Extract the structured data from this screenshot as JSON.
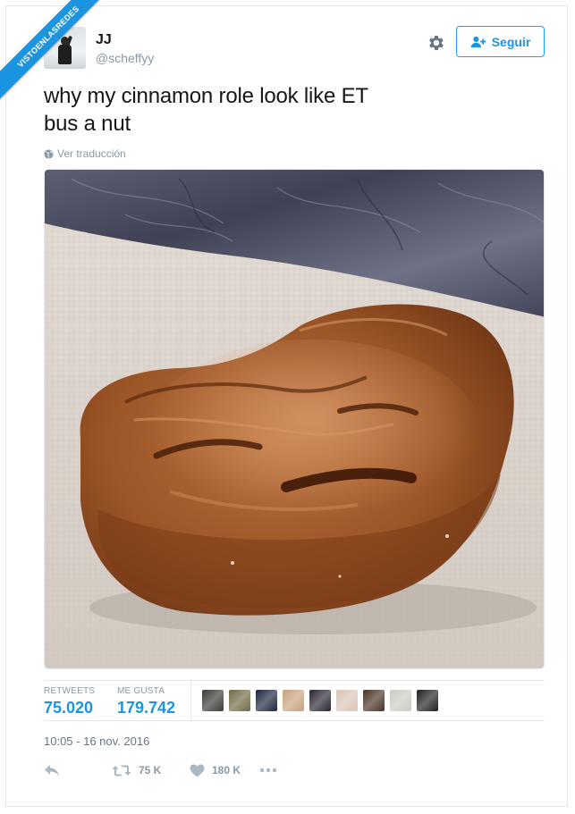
{
  "watermark": {
    "text": "VISTOENLASREDES"
  },
  "author": {
    "display_name": "JJ",
    "screen_name": "@scheffyy"
  },
  "header": {
    "follow_label": "Seguir",
    "settings_icon": "gear-icon",
    "follow_icon": "user-plus-icon"
  },
  "tweet": {
    "text": "why my cinnamon role look like ET\nbus a nut",
    "translate_label": "Ver traducción",
    "translate_icon": "globe-icon",
    "photo_subject": "photo"
  },
  "stats": {
    "retweets_label": "RETWEETS",
    "retweets_value": "75.020",
    "likes_label": "ME GUSTA",
    "likes_value": "179.742",
    "liker_avatars": [
      "#3a3b36",
      "#6f6a45",
      "#1c2640",
      "#c8a27c",
      "#2b2530",
      "#d9c4b5",
      "#4a3326",
      "#c7cbc2",
      "#22201e"
    ]
  },
  "timestamp": "10:05 - 16 nov. 2016",
  "actions": {
    "reply_icon": "reply-icon",
    "retweet_icon": "retweet-icon",
    "retweet_count": "75 K",
    "like_icon": "heart-icon",
    "like_count": "180 K",
    "more_icon": "more-icon"
  },
  "colors": {
    "accent": "#1b95e0",
    "muted": "#8899a6",
    "border": "#e1e8ed",
    "text": "#14171a"
  }
}
